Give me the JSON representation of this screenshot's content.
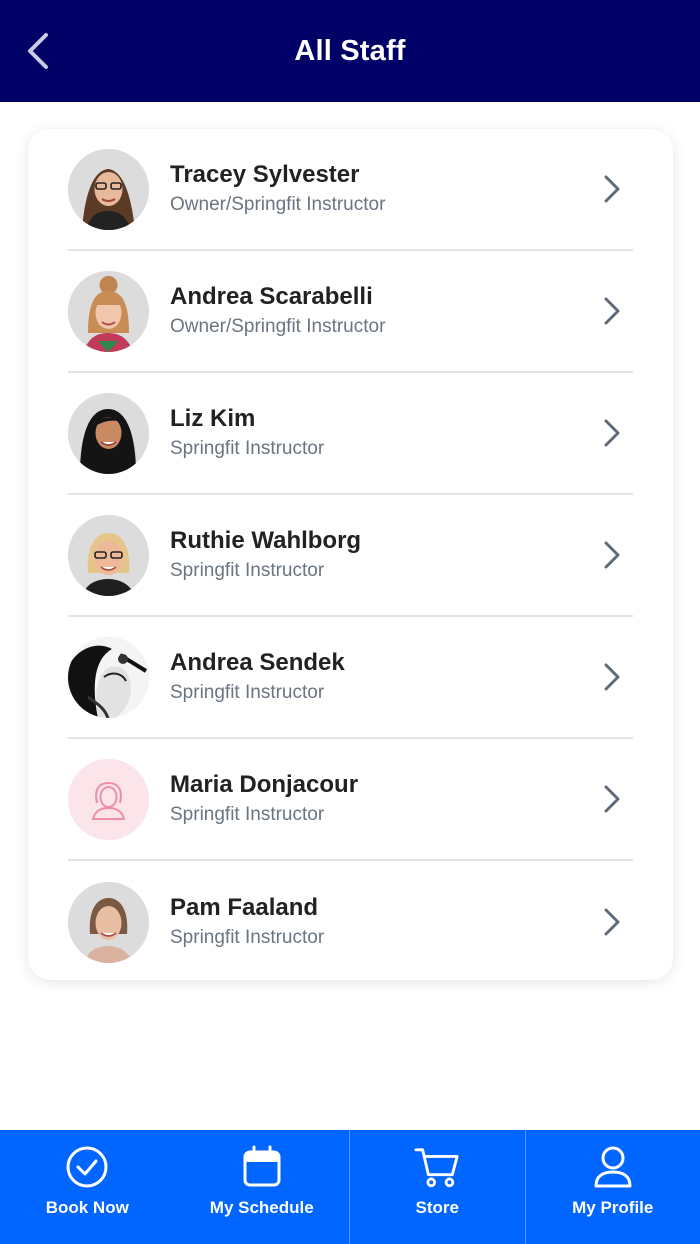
{
  "header": {
    "title": "All Staff",
    "back_icon": "chevron-left-icon",
    "bg_color": "#000066"
  },
  "staff": [
    {
      "name": "Tracey Sylvester",
      "role": "Owner/Springfit Instructor"
    },
    {
      "name": "Andrea Scarabelli",
      "role": "Owner/Springfit Instructor"
    },
    {
      "name": "Liz Kim",
      "role": "Springfit Instructor"
    },
    {
      "name": "Ruthie Wahlborg",
      "role": "Springfit Instructor"
    },
    {
      "name": "Andrea Sendek",
      "role": "Springfit Instructor"
    },
    {
      "name": "Maria Donjacour",
      "role": "Springfit Instructor"
    },
    {
      "name": "Pam Faaland",
      "role": "Springfit Instructor"
    }
  ],
  "bottom_nav": {
    "items": [
      {
        "label": "Book Now",
        "icon": "check-circle-icon"
      },
      {
        "label": "My Schedule",
        "icon": "calendar-icon"
      },
      {
        "label": "Store",
        "icon": "cart-icon"
      },
      {
        "label": "My Profile",
        "icon": "user-icon"
      }
    ],
    "bg_color": "#0066ff"
  }
}
